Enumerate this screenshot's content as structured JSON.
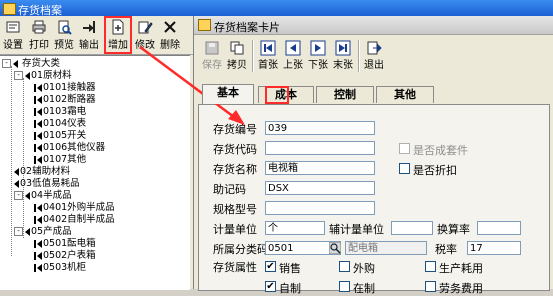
{
  "main_window": {
    "title": "存货档案"
  },
  "toolbar": [
    {
      "label": "设置",
      "icon": "settings-icon"
    },
    {
      "label": "打印",
      "icon": "printer-icon"
    },
    {
      "label": "预览",
      "icon": "preview-icon"
    },
    {
      "label": "输出",
      "icon": "export-icon"
    },
    {
      "label": "增加",
      "icon": "add-document-icon",
      "highlighted": true
    },
    {
      "label": "修改",
      "icon": "edit-icon"
    },
    {
      "label": "删除",
      "icon": "delete-icon"
    }
  ],
  "tree": {
    "root": "存货大类",
    "items": [
      {
        "label": "01原材料",
        "level": 1,
        "expand": "-"
      },
      {
        "label": "0101接触器",
        "level": 2
      },
      {
        "label": "0102断路器",
        "level": 2
      },
      {
        "label": "0103霜电",
        "level": 2
      },
      {
        "label": "0104仪表",
        "level": 2
      },
      {
        "label": "0105开关",
        "level": 2
      },
      {
        "label": "0106其他仪器",
        "level": 2
      },
      {
        "label": "0107其他",
        "level": 2
      },
      {
        "label": "02辅助材料",
        "level": 1
      },
      {
        "label": "03低值易耗品",
        "level": 1
      },
      {
        "label": "04半成品",
        "level": 1,
        "expand": "-"
      },
      {
        "label": "0401外购半成品",
        "level": 2
      },
      {
        "label": "0402自制半成品",
        "level": 2
      },
      {
        "label": "05产成品",
        "level": 1,
        "expand": "-"
      },
      {
        "label": "0501酝电箱",
        "level": 2
      },
      {
        "label": "0502户表箱",
        "level": 2
      },
      {
        "label": "0503机柜",
        "level": 2
      }
    ]
  },
  "card": {
    "title": "存货档案卡片",
    "toolbar": [
      {
        "label": "保存",
        "icon": "save-icon",
        "disabled": true
      },
      {
        "label": "拷贝",
        "icon": "copy-icon"
      },
      {
        "label": "首张",
        "icon": "first-record-icon"
      },
      {
        "label": "上张",
        "icon": "previous-record-icon"
      },
      {
        "label": "下张",
        "icon": "next-record-icon"
      },
      {
        "label": "末张",
        "icon": "last-record-icon"
      },
      {
        "label": "退出",
        "icon": "exit-icon"
      }
    ],
    "tabs": [
      "基本",
      "成本",
      "控制",
      "其他"
    ],
    "active_tab": "基本",
    "form": {
      "code_label": "存货编号",
      "code_value": "039",
      "alias_label": "存货代码",
      "alias_value": "",
      "name_label": "存货名称",
      "name_value": "电视箱",
      "mnemonic_label": "助记码",
      "mnemonic_value": "DSX",
      "spec_label": "规格型号",
      "spec_value": "",
      "unit_label": "计量单位",
      "unit_value": "个",
      "aux_unit_label": "辅计量单位",
      "aux_unit_value": "",
      "ratio_label": "换算率",
      "ratio_value": "",
      "category_label": "所属分类码",
      "category_code": "0501",
      "category_name": "配电箱",
      "tax_label": "税率",
      "tax_value": "17",
      "attr_label": "存货属性",
      "is_kit_label": "是否成套件",
      "is_kit": false,
      "is_discount_label": "是否折扣",
      "is_discount": false,
      "attributes": [
        {
          "label": "销售",
          "checked": true
        },
        {
          "label": "外购",
          "checked": false
        },
        {
          "label": "生产耗用",
          "checked": false
        },
        {
          "label": "自制",
          "checked": true
        },
        {
          "label": "在制",
          "checked": false
        },
        {
          "label": "劳务费用",
          "checked": false
        }
      ]
    }
  },
  "colors": {
    "annotation": "#ff2a2a",
    "titlebar": "#1c5fd4"
  }
}
